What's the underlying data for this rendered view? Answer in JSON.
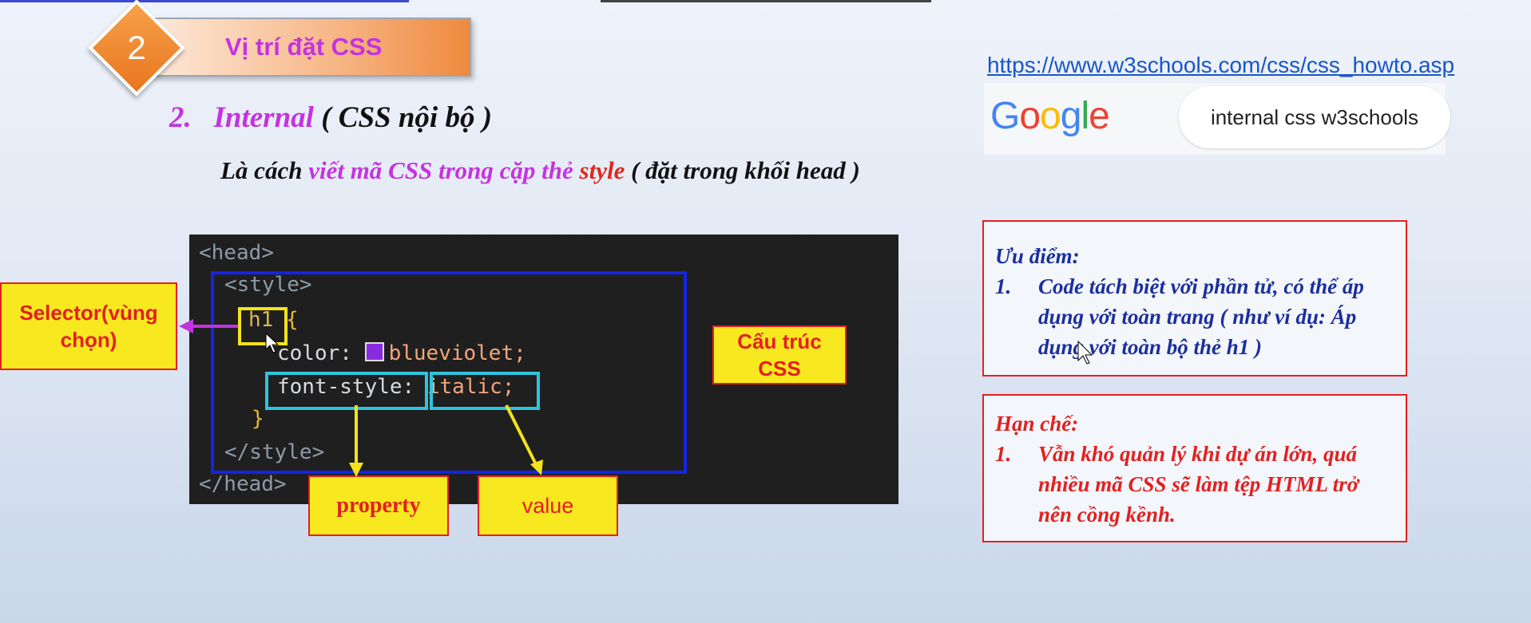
{
  "badge": {
    "number": "2",
    "title": "Vị trí đặt CSS"
  },
  "heading": {
    "number": "2.",
    "term": "Internal",
    "paren": "( CSS nội bộ )"
  },
  "description": {
    "prefix": "Là cách ",
    "highlight": "viết mã CSS trong cặp thẻ ",
    "style_word": "style",
    "suffix": " ( đặt trong khối head )"
  },
  "link": {
    "url": "https://www.w3schools.com/css/css_howto.asp"
  },
  "google": {
    "logo": [
      "G",
      "o",
      "o",
      "g",
      "l",
      "e"
    ],
    "query": "internal css w3schools"
  },
  "code": {
    "head_open": "<head>",
    "style_open": "<style>",
    "selector": "h1",
    "open_brace": " {",
    "color_prop": "color:",
    "color_value": "blueviolet;",
    "color_hex": "#8a2be2",
    "font_prop": "font-style:",
    "font_value": "italic;",
    "close_brace": "}",
    "style_close": "</style>",
    "head_close": "</head>"
  },
  "labels": {
    "selector": "Selector(vùng chọn)",
    "structure": "Cấu trúc CSS",
    "property": "property",
    "value": "value"
  },
  "pros": {
    "title": "Ưu điểm:",
    "items": [
      {
        "num": "1.",
        "text": "Code tách biệt với phần tử, có thể áp dụng với toàn trang ( như ví dụ: Áp dụng với toàn bộ thẻ h1 )"
      }
    ]
  },
  "cons": {
    "title": "Hạn chế:",
    "items": [
      {
        "num": "1.",
        "text": "Vẫn khó quản lý khi dự án lớn, quá nhiều mã CSS sẽ làm tệp HTML trở nên cồng kềnh."
      }
    ]
  },
  "colors": {
    "accent_purple": "#c433e0",
    "accent_red": "#e32020",
    "frame_blue": "#1424e6",
    "label_yellow": "#f8e81f",
    "highlight_cyan": "#2ec4dc"
  }
}
